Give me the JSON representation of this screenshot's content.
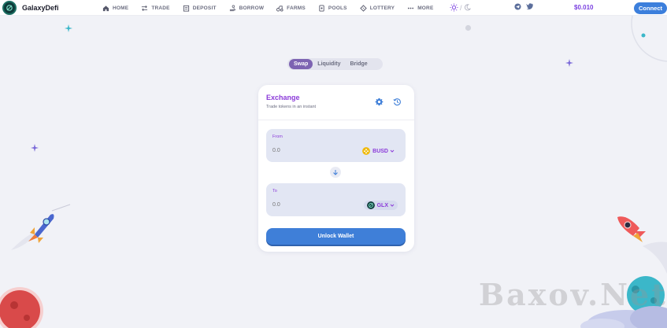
{
  "brand": {
    "name": "GalaxyDefi"
  },
  "nav": {
    "items": [
      {
        "label": "HOME",
        "icon": "home-icon"
      },
      {
        "label": "TRADE",
        "icon": "trade-icon"
      },
      {
        "label": "DEPOSIT",
        "icon": "deposit-icon"
      },
      {
        "label": "BORROW",
        "icon": "borrow-icon"
      },
      {
        "label": "FARMS",
        "icon": "farms-icon"
      },
      {
        "label": "POOLS",
        "icon": "pools-icon"
      },
      {
        "label": "LOTTERY",
        "icon": "lottery-icon"
      },
      {
        "label": "MORE",
        "icon": "more-icon"
      }
    ],
    "theme_separator": "/",
    "balance": "$0.010",
    "connect_label": "Connect"
  },
  "tabs": [
    {
      "label": "Swap",
      "active": true
    },
    {
      "label": "Liquidity",
      "active": false
    },
    {
      "label": "Bridge",
      "active": false
    }
  ],
  "exchange": {
    "title": "Exchange",
    "subtitle": "Trade tokens in an instant",
    "from": {
      "label": "From",
      "value": "0.0",
      "token": "BUSD"
    },
    "to": {
      "label": "To",
      "value": "0.0",
      "token": "GLX"
    },
    "unlock_label": "Unlock Wallet"
  },
  "watermark": "Baxov.Net",
  "colors": {
    "accent": "#8b3ad9",
    "primary_button": "#3f7fd8",
    "tab_active": "#7d63b2",
    "background": "#f1f2f7"
  }
}
